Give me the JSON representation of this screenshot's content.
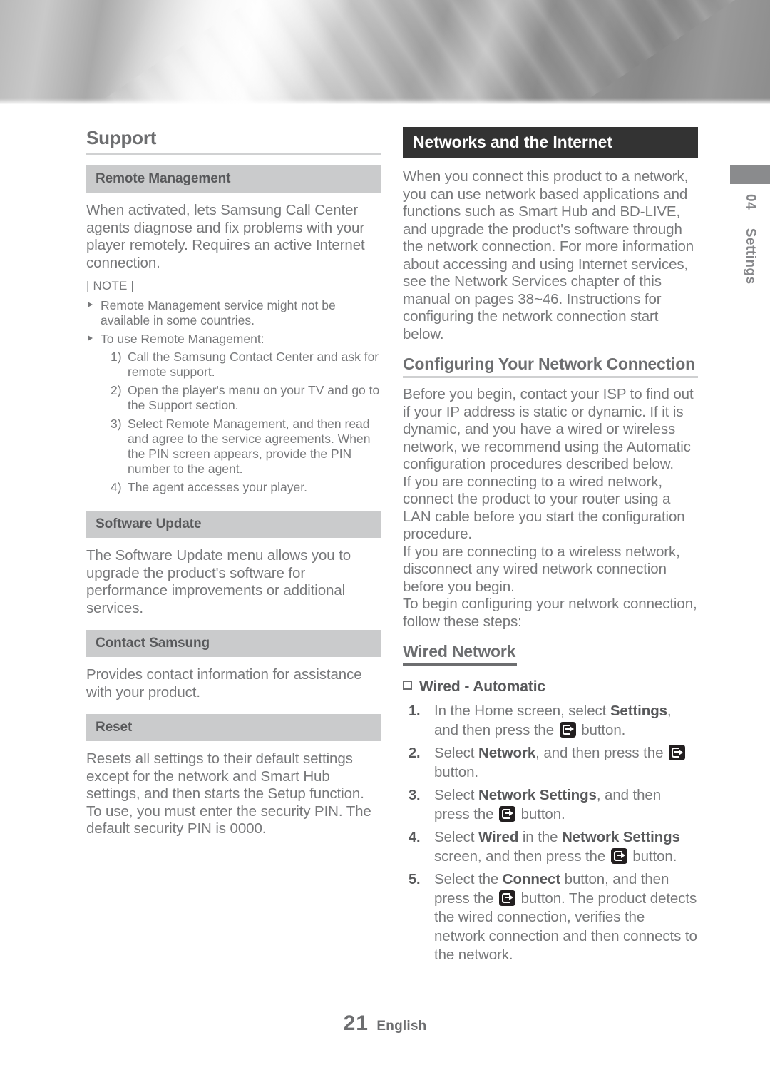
{
  "page": {
    "number": "21",
    "language": "English",
    "side_tab_chapter_number": "04",
    "side_tab_chapter_name": "Settings",
    "colors": {
      "black_bar": "#333333",
      "gray_bar": "#cacbcc",
      "body_text": "#77787a",
      "heading_text": "#6d6e70"
    }
  },
  "left_column": {
    "chapter_heading": "Support",
    "sections": [
      {
        "bar_title": "Remote Management",
        "paragraphs": [
          "When activated, lets Samsung Call Center agents diagnose and fix problems with your player remotely. Requires an active Internet connection."
        ],
        "note_label": "| NOTE |",
        "notes": [
          {
            "text": "Remote Management service might not be available in some countries."
          },
          {
            "text": "To use Remote Management:",
            "substeps": [
              {
                "num": "1)",
                "text": "Call the Samsung Contact Center and ask for remote support."
              },
              {
                "num": "2)",
                "text": "Open the player's menu on your TV and go to the Support section."
              },
              {
                "num": "3)",
                "text": "Select Remote Management, and then read and agree to the service agreements. When the PIN screen appears, provide the PIN number to the agent."
              },
              {
                "num": "4)",
                "text": "The agent accesses your player."
              }
            ]
          }
        ]
      },
      {
        "bar_title": "Software Update",
        "paragraphs": [
          "The Software Update menu allows you to upgrade the product's software for performance improvements or additional services."
        ]
      },
      {
        "bar_title": "Contact Samsung",
        "paragraphs": [
          "Provides contact information for assistance with your product."
        ]
      },
      {
        "bar_title": "Reset",
        "paragraphs": [
          "Resets all settings to their default settings except for the network and Smart Hub settings, and then starts the Setup function. To use, you must enter the security PIN. The default security PIN is 0000."
        ]
      }
    ]
  },
  "right_column": {
    "black_bar_title": "Networks and the Internet",
    "intro_paragraph": "When you connect this product to a network, you can use network based applications and functions such as Smart Hub and BD-LIVE, and upgrade the product's software through the network connection. For more information about accessing and using Internet services, see the Network Services chapter of this manual on pages 38~46. Instructions for configuring the network connection start below.",
    "configuring_heading": "Configuring Your Network Connection",
    "configuring_paragraphs": [
      "Before you begin, contact your ISP to find out if your IP address is static or dynamic. If it is dynamic, and you have a wired or wireless network, we recommend using the Automatic configuration procedures described below.",
      "If you are connecting to a wired network, connect the product to your router using a LAN cable before you start the configuration procedure.",
      "If you are connecting to a wireless network, disconnect any wired network connection before you begin.",
      "To begin configuring your network connection, follow these steps:"
    ],
    "wired_network_heading": "Wired Network",
    "wired_automatic_heading": "Wired - Automatic",
    "steps": [
      {
        "num": "1.",
        "parts": [
          {
            "t": "text",
            "v": "In the Home screen, select "
          },
          {
            "t": "bold",
            "v": "Settings"
          },
          {
            "t": "text",
            "v": ", and then press the "
          },
          {
            "t": "icon",
            "v": "enter-button-icon"
          },
          {
            "t": "text",
            "v": " button."
          }
        ]
      },
      {
        "num": "2.",
        "parts": [
          {
            "t": "text",
            "v": "Select "
          },
          {
            "t": "bold",
            "v": "Network"
          },
          {
            "t": "text",
            "v": ", and then press the "
          },
          {
            "t": "icon",
            "v": "enter-button-icon"
          },
          {
            "t": "text",
            "v": " button."
          }
        ]
      },
      {
        "num": "3.",
        "parts": [
          {
            "t": "text",
            "v": "Select "
          },
          {
            "t": "bold",
            "v": "Network Settings"
          },
          {
            "t": "text",
            "v": ", and then press the "
          },
          {
            "t": "icon",
            "v": "enter-button-icon"
          },
          {
            "t": "text",
            "v": " button."
          }
        ]
      },
      {
        "num": "4.",
        "parts": [
          {
            "t": "text",
            "v": "Select "
          },
          {
            "t": "bold",
            "v": "Wired"
          },
          {
            "t": "text",
            "v": " in the "
          },
          {
            "t": "bold",
            "v": "Network Settings"
          },
          {
            "t": "text",
            "v": " screen, and then press the "
          },
          {
            "t": "icon",
            "v": "enter-button-icon"
          },
          {
            "t": "text",
            "v": " button."
          }
        ]
      },
      {
        "num": "5.",
        "parts": [
          {
            "t": "text",
            "v": "Select the "
          },
          {
            "t": "bold",
            "v": "Connect"
          },
          {
            "t": "text",
            "v": " button, and then press the "
          },
          {
            "t": "icon",
            "v": "enter-button-icon"
          },
          {
            "t": "text",
            "v": " button. The product detects the wired connection, verifies the network connection and then connects to the network."
          }
        ]
      }
    ]
  }
}
